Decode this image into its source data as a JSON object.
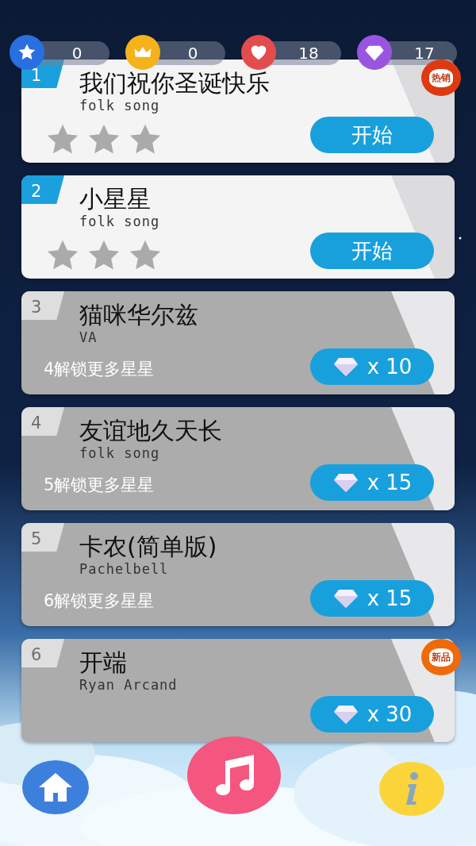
{
  "stats": [
    {
      "kind": "star",
      "value": "0"
    },
    {
      "kind": "crown",
      "value": "0"
    },
    {
      "kind": "heart",
      "value": "18"
    },
    {
      "kind": "diamond",
      "value": "17"
    }
  ],
  "songs": [
    {
      "rank": "1",
      "title": "我们祝你圣诞快乐",
      "artist": "folk song",
      "locked": false,
      "stars": 0,
      "action": "开始",
      "badge": {
        "label": "热销",
        "color": "#dd3a12"
      }
    },
    {
      "rank": "2",
      "title": "小星星",
      "artist": "folk song",
      "locked": false,
      "stars": 0,
      "action": "开始"
    },
    {
      "rank": "3",
      "title": "猫咪华尔兹",
      "artist": "VA",
      "locked": true,
      "hint": "4解锁更多星星",
      "price": "x 10"
    },
    {
      "rank": "4",
      "title": "友谊地久天长",
      "artist": "folk song",
      "locked": true,
      "hint": "5解锁更多星星",
      "price": "x 15"
    },
    {
      "rank": "5",
      "title": "卡农(简单版)",
      "artist": "Pachelbell",
      "locked": true,
      "hint": "6解锁更多星星",
      "price": "x 15"
    },
    {
      "rank": "6",
      "title": "开端",
      "artist": "Ryan Arcand",
      "locked": true,
      "price": "x 30",
      "badge": {
        "label": "新品",
        "color": "#f06a0a"
      }
    }
  ]
}
